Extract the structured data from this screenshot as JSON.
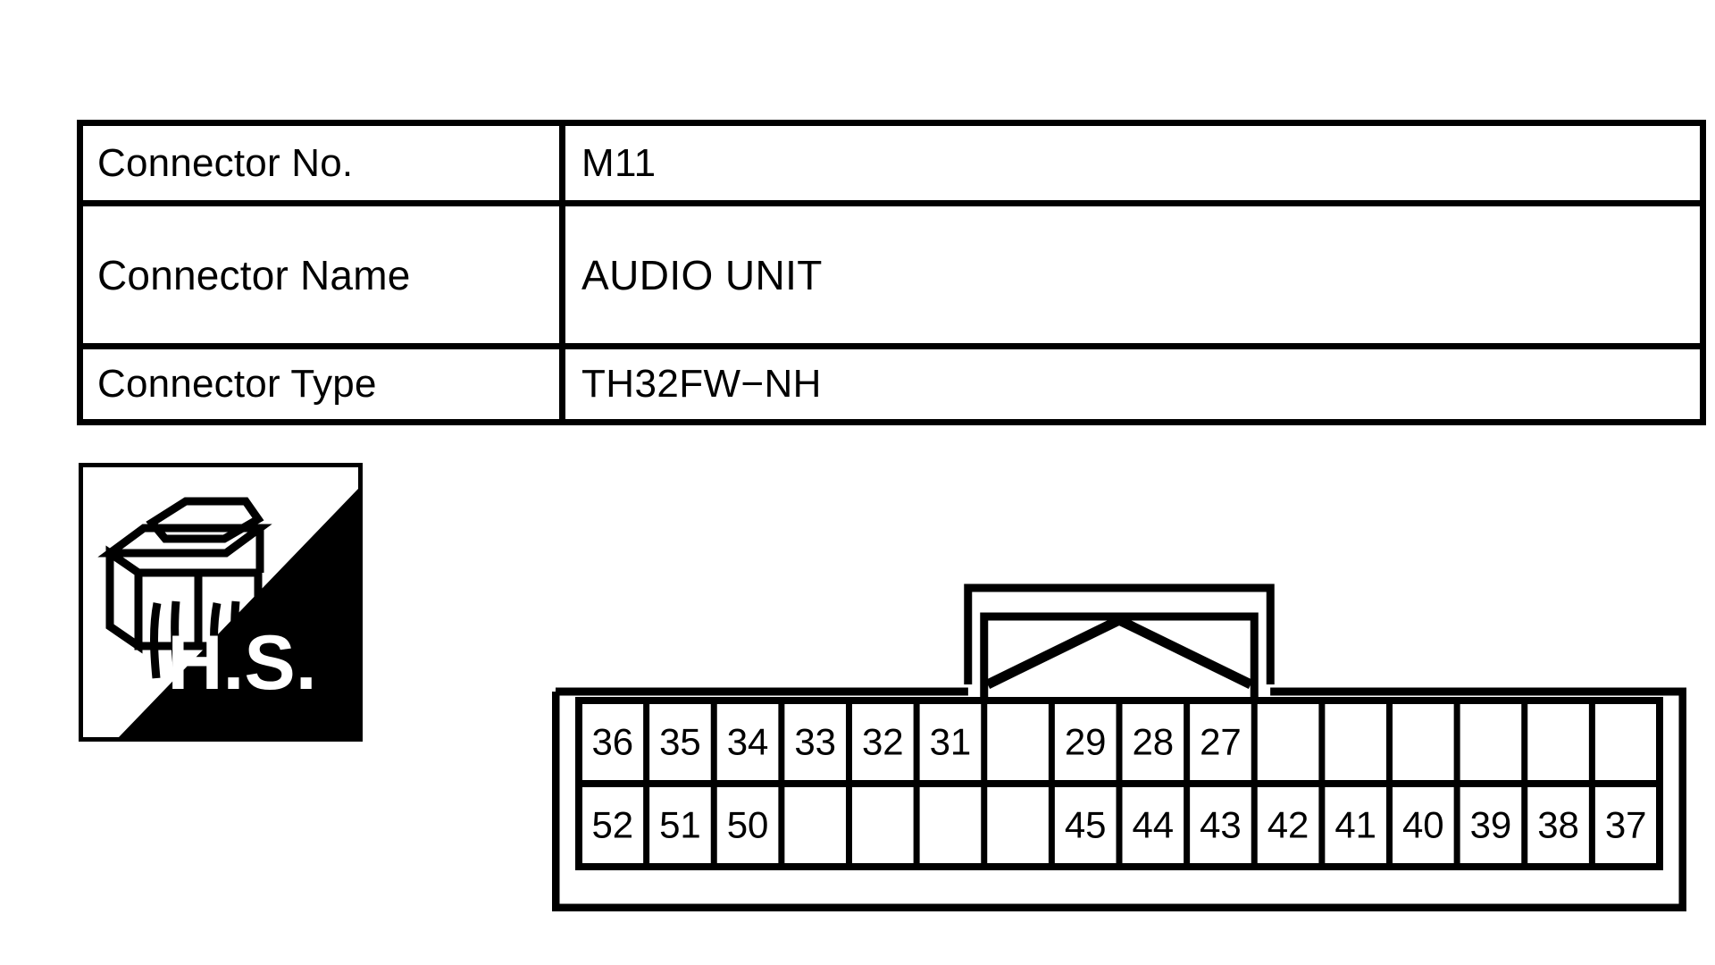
{
  "info_table": {
    "rows": [
      {
        "label": "Connector No.",
        "value": "M11"
      },
      {
        "label": "Connector Name",
        "value": "AUDIO UNIT"
      },
      {
        "label": "Connector Type",
        "value": "TH32FW−NH"
      }
    ]
  },
  "hs_badge": {
    "text": "H.S.",
    "icon": "connector-harness-icon",
    "background_color": "#ffffff",
    "fill_color": "#000000"
  },
  "connector": {
    "columns": 16,
    "rows": 2,
    "latch_tab": {
      "present": true,
      "shape": "chevron-peak",
      "spans_columns": [
        7,
        10
      ]
    },
    "top_row": [
      "36",
      "35",
      "34",
      "33",
      "32",
      "31",
      "",
      "29",
      "28",
      "27",
      "",
      "",
      "",
      "",
      "",
      ""
    ],
    "bottom_row": [
      "52",
      "51",
      "50",
      "",
      "",
      "",
      "",
      "45",
      "44",
      "43",
      "42",
      "41",
      "40",
      "39",
      "38",
      "37"
    ]
  },
  "colors": {
    "ink": "#000000",
    "paper": "#ffffff"
  }
}
